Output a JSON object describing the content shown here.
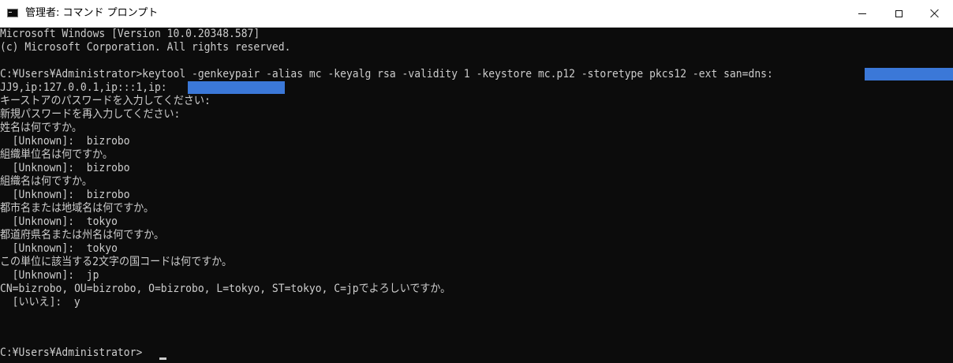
{
  "window": {
    "title": "管理者: コマンド プロンプト",
    "app_icon": "console-icon",
    "controls": {
      "minimize_icon": "minimize-icon",
      "maximize_icon": "maximize-icon",
      "close_icon": "close-icon"
    }
  },
  "console": {
    "background_color": "#0c0c0c",
    "text_color": "#cccccc",
    "redaction_color": "#3b78d8",
    "lines": [
      "Microsoft Windows [Version 10.0.20348.587]",
      "(c) Microsoft Corporation. All rights reserved.",
      "",
      "C:¥Users¥Administrator>keytool -genkeypair -alias mc -keyalg rsa -validity 1 -keystore mc.p12 -storetype pkcs12 -ext san=dns:",
      "JJ9,ip:127.0.0.1,ip:::1,ip:",
      "キーストアのパスワードを入力してください:",
      "新規パスワードを再入力してください:",
      "姓名は何ですか。",
      "  [Unknown]:  bizrobo",
      "組織単位名は何ですか。",
      "  [Unknown]:  bizrobo",
      "組織名は何ですか。",
      "  [Unknown]:  bizrobo",
      "都市名または地域名は何ですか。",
      "  [Unknown]:  tokyo",
      "都道府県名または州名は何ですか。",
      "  [Unknown]:  tokyo",
      "この単位に該当する2文字の国コードは何ですか。",
      "  [Unknown]:  jp",
      "CN=bizrobo, OU=bizrobo, O=bizrobo, L=tokyo, ST=tokyo, C=jpでよろしいですか。",
      "  [いいえ]:  y",
      "",
      "",
      "C:¥Users¥Administrator>"
    ]
  }
}
